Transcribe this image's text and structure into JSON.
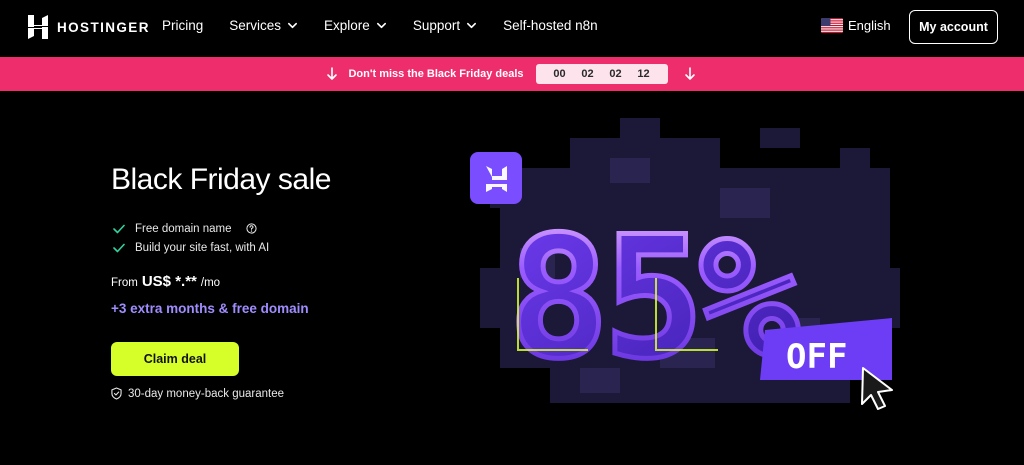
{
  "brand": {
    "name": "HOSTINGER"
  },
  "nav": {
    "items": [
      {
        "label": "Pricing",
        "dropdown": false
      },
      {
        "label": "Services",
        "dropdown": true
      },
      {
        "label": "Explore",
        "dropdown": true
      },
      {
        "label": "Support",
        "dropdown": true
      },
      {
        "label": "Self-hosted n8n",
        "dropdown": false
      }
    ],
    "language": "English",
    "account_label": "My account"
  },
  "promo": {
    "text": "Don't miss the Black Friday deals",
    "countdown": [
      "00",
      "02",
      "02",
      "12"
    ],
    "background": "#ee2d6d"
  },
  "hero": {
    "title": "Black Friday sale",
    "features": [
      {
        "label": "Free domain name",
        "has_help": true
      },
      {
        "label": "Build your site fast, with AI",
        "has_help": false
      }
    ],
    "price_prefix": "From",
    "price_currency": "US$ *.**",
    "price_suffix": "/mo",
    "extra_offer": "+3 extra months & free domain",
    "cta_label": "Claim deal",
    "guarantee": "30-day money-back guarantee",
    "accent_purple": "#a18cff",
    "cta_color": "#d6ff2a"
  },
  "promo_art": {
    "discount": "85%",
    "off_label": "OFF",
    "icons": [
      "hostinger-logo-badge",
      "cursor-arrow-icon"
    ]
  }
}
